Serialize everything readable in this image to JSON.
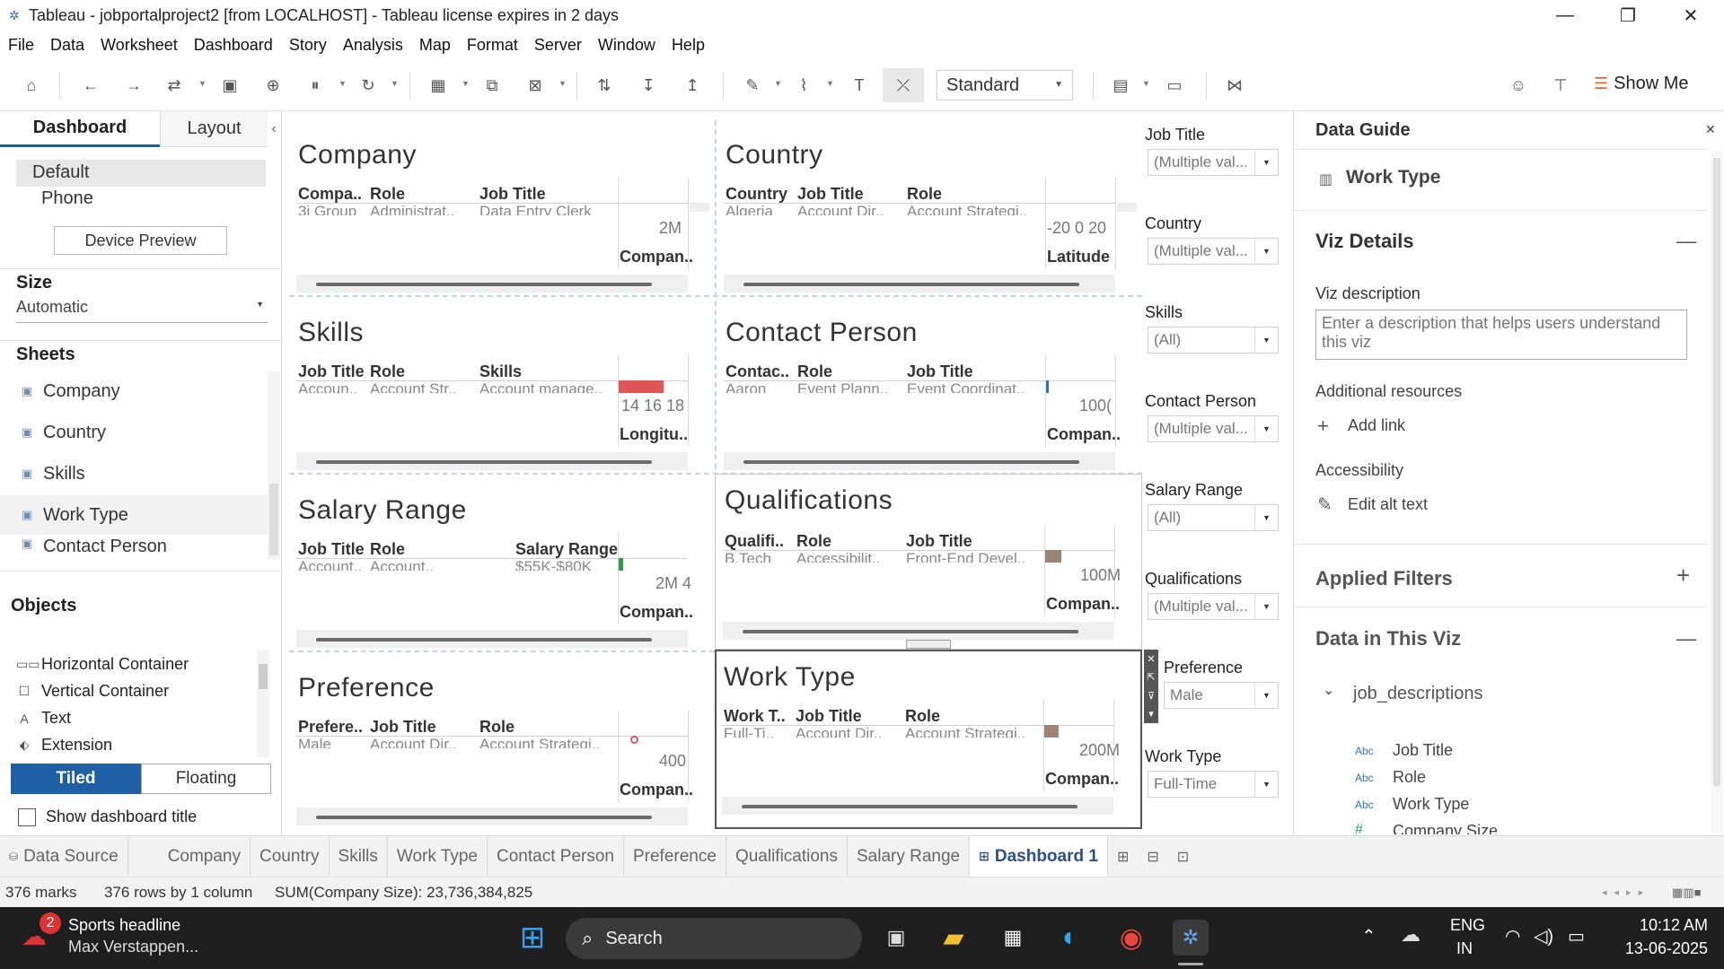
{
  "window": {
    "title": "Tableau - jobportalproject2 [from LOCALHOST] - Tableau license expires in 2 days"
  },
  "menu": [
    "File",
    "Data",
    "Worksheet",
    "Dashboard",
    "Story",
    "Analysis",
    "Map",
    "Format",
    "Server",
    "Window",
    "Help"
  ],
  "toolbar": {
    "fit_select": "Standard",
    "show_me": "Show Me"
  },
  "left": {
    "tabs": {
      "dashboard": "Dashboard",
      "layout": "Layout"
    },
    "devices": {
      "default": "Default",
      "phone": "Phone",
      "preview_button": "Device Preview"
    },
    "size": {
      "title": "Size",
      "value": "Automatic"
    },
    "sheets_title": "Sheets",
    "sheets": [
      "Company",
      "Country",
      "Skills",
      "Work Type",
      "Contact Person"
    ],
    "objects_title": "Objects",
    "objects": [
      "Horizontal Container",
      "Vertical Container",
      "Text",
      "Extension"
    ],
    "tiled": "Tiled",
    "floating": "Floating",
    "show_title": "Show dashboard title"
  },
  "tiles": {
    "company": {
      "title": "Company",
      "h1": "Compa..",
      "h2": "Role",
      "h3": "Job Title",
      "c1": "3i Group",
      "c2": "Administrat..",
      "c3": "Data Entry Clerk",
      "axis": "2M",
      "label": "Compan.."
    },
    "country": {
      "title": "Country",
      "h1": "Country",
      "h2": "Job Title",
      "h3": "Role",
      "c1": "Algeria",
      "c2": "Account Dir..",
      "c3": "Account Strategi..",
      "axis": "-20  0  20",
      "label": "Latitude"
    },
    "skills": {
      "title": "Skills",
      "h1": "Job Title",
      "h2": "Role",
      "h3": "Skills",
      "c1": "Accoun..",
      "c2": "Account Str..",
      "c3": "Account manage..",
      "axis": "14 16 18",
      "label": "Longitu.."
    },
    "contact": {
      "title": "Contact Person",
      "h1": "Contac..",
      "h2": "Role",
      "h3": "Job Title",
      "c1": "Aaron",
      "c2": "Event Plann..",
      "c3": "Event Coordinat..",
      "axis": "100(",
      "label": "Compan.."
    },
    "salary": {
      "title": "Salary Range",
      "h1": "Job Title",
      "h2": "Role",
      "h3": "Salary Range",
      "c1": "Account..",
      "c2": "Account..",
      "c3": "$55K-$80K",
      "axis": "2M  4",
      "label": "Compan.."
    },
    "qual": {
      "title": "Qualifications",
      "h1": "Qualifi..",
      "h2": "Role",
      "h3": "Job Title",
      "c1": "B.Tech",
      "c2": "Accessibilit..",
      "c3": "Front-End Devel..",
      "axis": "100M",
      "label": "Compan.."
    },
    "pref": {
      "title": "Preference",
      "h1": "Prefere..",
      "h2": "Job Title",
      "h3": "Role",
      "c1": "Male",
      "c2": "Account Dir..",
      "c3": "Account Strategi..",
      "axis": "400",
      "label": "Compan.."
    },
    "worktype": {
      "title": "Work Type",
      "h1": "Work T..",
      "h2": "Job Title",
      "h3": "Role",
      "c1": "Full-Ti..",
      "c2": "Account Dir..",
      "c3": "Account Strategi..",
      "axis": "200M",
      "label": "Compan.."
    }
  },
  "filters": [
    {
      "title": "Job Title",
      "value": "(Multiple val..."
    },
    {
      "title": "Country",
      "value": "(Multiple val..."
    },
    {
      "title": "Skills",
      "value": "(All)"
    },
    {
      "title": "Contact Person",
      "value": "(Multiple val..."
    },
    {
      "title": "Salary Range",
      "value": "(All)"
    },
    {
      "title": "Qualifications",
      "value": "(Multiple val..."
    },
    {
      "title": "Preference",
      "value": "Male"
    },
    {
      "title": "Work Type",
      "value": "Full-Time"
    }
  ],
  "guide": {
    "title": "Data Guide",
    "sheet": "Work Type",
    "viz_details": "Viz Details",
    "viz_desc_label": "Viz description",
    "viz_desc_placeholder": "Enter a description that helps users understand this viz",
    "additional": "Additional resources",
    "add_link": "Add link",
    "accessibility": "Accessibility",
    "edit_alt": "Edit alt text",
    "applied_filters": "Applied Filters",
    "data_in_viz": "Data in This Viz",
    "datasource": "job_descriptions",
    "fields": [
      "Job Title",
      "Role",
      "Work Type",
      "Company Size"
    ]
  },
  "sheet_tabs": [
    "Data Source",
    "Company",
    "Country",
    "Skills",
    "Work Type",
    "Contact Person",
    "Preference",
    "Qualifications",
    "Salary Range",
    "Dashboard 1"
  ],
  "status": {
    "marks": "376 marks",
    "rows": "376 rows by 1 column",
    "sum": "SUM(Company Size): 23,736,384,825"
  },
  "taskbar": {
    "news_badge": "2",
    "news_title": "Sports headline",
    "news_sub": "Max Verstappen...",
    "search": "Search",
    "lang1": "ENG",
    "lang2": "IN",
    "time": "10:12 AM",
    "date": "13-06-2025"
  },
  "colors": {
    "accent": "#1f5fa6",
    "salmon_bar": "#e05555",
    "green_bar": "#2f9b47",
    "taupe_bar": "#9a8478",
    "tiled_bg": "#1f5fa6"
  }
}
